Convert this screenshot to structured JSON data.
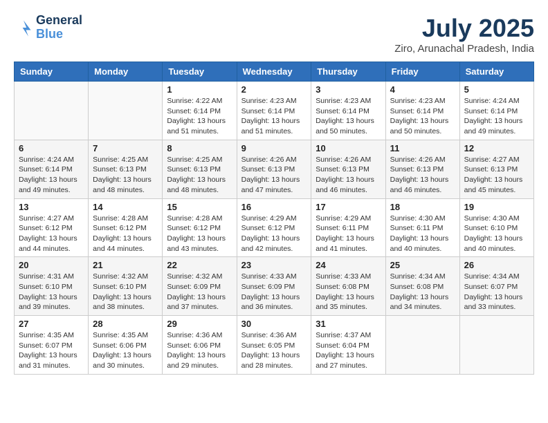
{
  "header": {
    "logo_line1": "General",
    "logo_line2": "Blue",
    "month_title": "July 2025",
    "location": "Ziro, Arunachal Pradesh, India"
  },
  "weekdays": [
    "Sunday",
    "Monday",
    "Tuesday",
    "Wednesday",
    "Thursday",
    "Friday",
    "Saturday"
  ],
  "weeks": [
    [
      null,
      null,
      {
        "day": "1",
        "sunrise": "4:22 AM",
        "sunset": "6:14 PM",
        "daylight": "13 hours and 51 minutes."
      },
      {
        "day": "2",
        "sunrise": "4:23 AM",
        "sunset": "6:14 PM",
        "daylight": "13 hours and 51 minutes."
      },
      {
        "day": "3",
        "sunrise": "4:23 AM",
        "sunset": "6:14 PM",
        "daylight": "13 hours and 50 minutes."
      },
      {
        "day": "4",
        "sunrise": "4:23 AM",
        "sunset": "6:14 PM",
        "daylight": "13 hours and 50 minutes."
      },
      {
        "day": "5",
        "sunrise": "4:24 AM",
        "sunset": "6:14 PM",
        "daylight": "13 hours and 49 minutes."
      }
    ],
    [
      {
        "day": "6",
        "sunrise": "4:24 AM",
        "sunset": "6:14 PM",
        "daylight": "13 hours and 49 minutes."
      },
      {
        "day": "7",
        "sunrise": "4:25 AM",
        "sunset": "6:13 PM",
        "daylight": "13 hours and 48 minutes."
      },
      {
        "day": "8",
        "sunrise": "4:25 AM",
        "sunset": "6:13 PM",
        "daylight": "13 hours and 48 minutes."
      },
      {
        "day": "9",
        "sunrise": "4:26 AM",
        "sunset": "6:13 PM",
        "daylight": "13 hours and 47 minutes."
      },
      {
        "day": "10",
        "sunrise": "4:26 AM",
        "sunset": "6:13 PM",
        "daylight": "13 hours and 46 minutes."
      },
      {
        "day": "11",
        "sunrise": "4:26 AM",
        "sunset": "6:13 PM",
        "daylight": "13 hours and 46 minutes."
      },
      {
        "day": "12",
        "sunrise": "4:27 AM",
        "sunset": "6:13 PM",
        "daylight": "13 hours and 45 minutes."
      }
    ],
    [
      {
        "day": "13",
        "sunrise": "4:27 AM",
        "sunset": "6:12 PM",
        "daylight": "13 hours and 44 minutes."
      },
      {
        "day": "14",
        "sunrise": "4:28 AM",
        "sunset": "6:12 PM",
        "daylight": "13 hours and 44 minutes."
      },
      {
        "day": "15",
        "sunrise": "4:28 AM",
        "sunset": "6:12 PM",
        "daylight": "13 hours and 43 minutes."
      },
      {
        "day": "16",
        "sunrise": "4:29 AM",
        "sunset": "6:12 PM",
        "daylight": "13 hours and 42 minutes."
      },
      {
        "day": "17",
        "sunrise": "4:29 AM",
        "sunset": "6:11 PM",
        "daylight": "13 hours and 41 minutes."
      },
      {
        "day": "18",
        "sunrise": "4:30 AM",
        "sunset": "6:11 PM",
        "daylight": "13 hours and 40 minutes."
      },
      {
        "day": "19",
        "sunrise": "4:30 AM",
        "sunset": "6:10 PM",
        "daylight": "13 hours and 40 minutes."
      }
    ],
    [
      {
        "day": "20",
        "sunrise": "4:31 AM",
        "sunset": "6:10 PM",
        "daylight": "13 hours and 39 minutes."
      },
      {
        "day": "21",
        "sunrise": "4:32 AM",
        "sunset": "6:10 PM",
        "daylight": "13 hours and 38 minutes."
      },
      {
        "day": "22",
        "sunrise": "4:32 AM",
        "sunset": "6:09 PM",
        "daylight": "13 hours and 37 minutes."
      },
      {
        "day": "23",
        "sunrise": "4:33 AM",
        "sunset": "6:09 PM",
        "daylight": "13 hours and 36 minutes."
      },
      {
        "day": "24",
        "sunrise": "4:33 AM",
        "sunset": "6:08 PM",
        "daylight": "13 hours and 35 minutes."
      },
      {
        "day": "25",
        "sunrise": "4:34 AM",
        "sunset": "6:08 PM",
        "daylight": "13 hours and 34 minutes."
      },
      {
        "day": "26",
        "sunrise": "4:34 AM",
        "sunset": "6:07 PM",
        "daylight": "13 hours and 33 minutes."
      }
    ],
    [
      {
        "day": "27",
        "sunrise": "4:35 AM",
        "sunset": "6:07 PM",
        "daylight": "13 hours and 31 minutes."
      },
      {
        "day": "28",
        "sunrise": "4:35 AM",
        "sunset": "6:06 PM",
        "daylight": "13 hours and 30 minutes."
      },
      {
        "day": "29",
        "sunrise": "4:36 AM",
        "sunset": "6:06 PM",
        "daylight": "13 hours and 29 minutes."
      },
      {
        "day": "30",
        "sunrise": "4:36 AM",
        "sunset": "6:05 PM",
        "daylight": "13 hours and 28 minutes."
      },
      {
        "day": "31",
        "sunrise": "4:37 AM",
        "sunset": "6:04 PM",
        "daylight": "13 hours and 27 minutes."
      },
      null,
      null
    ]
  ]
}
